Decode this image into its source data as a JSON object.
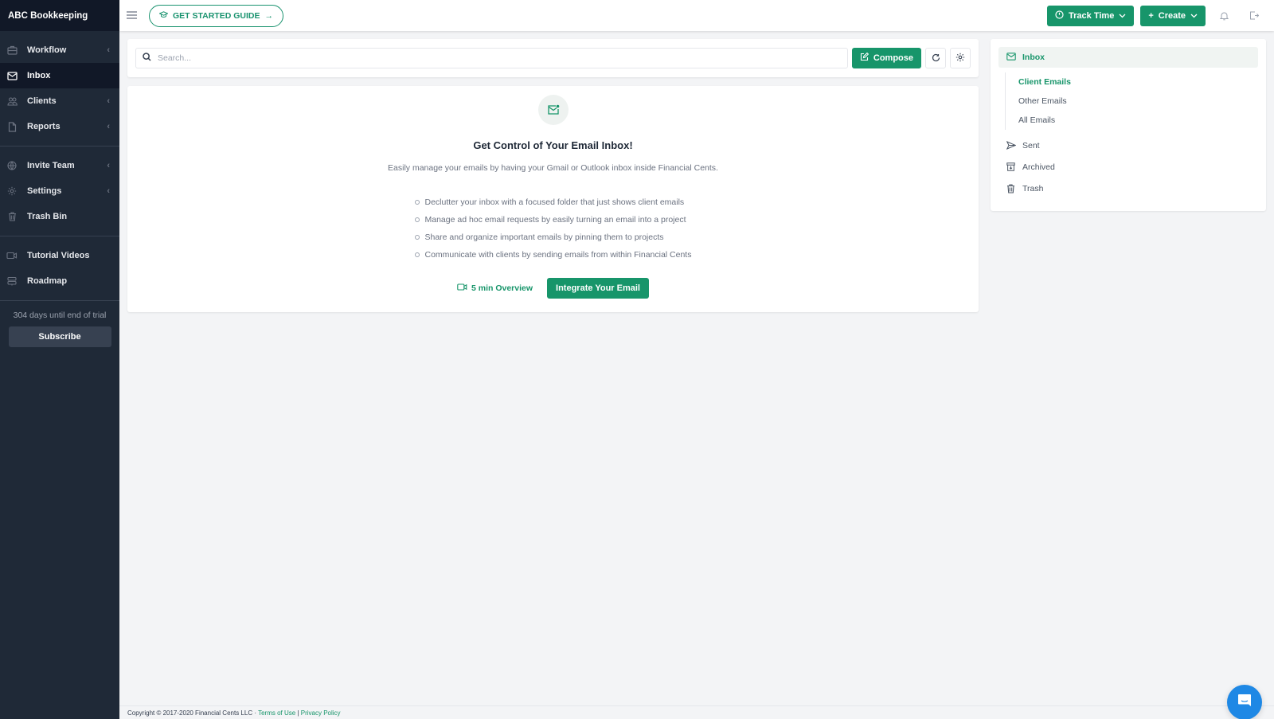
{
  "brand": "ABC Bookkeeping",
  "sidebar": {
    "items": [
      {
        "label": "Workflow",
        "icon": "briefcase-icon",
        "chevron": true
      },
      {
        "label": "Inbox",
        "icon": "mail-icon",
        "active": true
      },
      {
        "label": "Clients",
        "icon": "users-icon",
        "chevron": true
      },
      {
        "label": "Reports",
        "icon": "file-icon",
        "chevron": true
      },
      {
        "label": "Invite Team",
        "icon": "globe-icon",
        "chevron": true
      },
      {
        "label": "Settings",
        "icon": "gear-icon",
        "chevron": true
      },
      {
        "label": "Trash Bin",
        "icon": "trash-icon"
      },
      {
        "label": "Tutorial Videos",
        "icon": "video-icon"
      },
      {
        "label": "Roadmap",
        "icon": "signpost-icon"
      }
    ],
    "chevron_glyph": "‹",
    "trial_text": "304 days until end of trial",
    "subscribe_label": "Subscribe"
  },
  "topbar": {
    "guide_label": "GET STARTED GUIDE",
    "guide_arrow": "→",
    "track_time_label": "Track Time",
    "create_label": "Create",
    "create_plus": "+"
  },
  "search": {
    "placeholder": "Search...",
    "value": ""
  },
  "toolbar": {
    "compose_label": "Compose"
  },
  "empty_state": {
    "title": "Get Control of Your Email Inbox!",
    "subtitle": "Easily manage your emails by having your Gmail or Outlook inbox inside Financial Cents.",
    "features": [
      "Declutter your inbox with a focused folder that just shows client emails",
      "Manage ad hoc email requests by easily turning an email into a project",
      "Share and organize important emails by pinning them to projects",
      "Communicate with clients by sending emails from within Financial Cents"
    ],
    "overview_label": "5 min Overview",
    "integrate_label": "Integrate Your Email"
  },
  "folders": {
    "inbox_label": "Inbox",
    "sub_folders": [
      {
        "label": "Client Emails",
        "active": true
      },
      {
        "label": "Other Emails"
      },
      {
        "label": "All Emails"
      }
    ],
    "others": [
      {
        "label": "Sent",
        "icon": "send-icon"
      },
      {
        "label": "Archived",
        "icon": "archive-icon"
      },
      {
        "label": "Trash",
        "icon": "trash-icon"
      }
    ]
  },
  "footer": {
    "copyright": "Copyright © 2017-2020 Financial Cents LLC",
    "sep1": "·",
    "terms": "Terms of Use",
    "sep2": "|",
    "privacy": "Privacy Policy"
  },
  "colors": {
    "accent": "#17956a",
    "sidebar_bg": "#1f2937",
    "sidebar_header_bg": "#111827",
    "chat_bubble": "#1e88e5"
  }
}
